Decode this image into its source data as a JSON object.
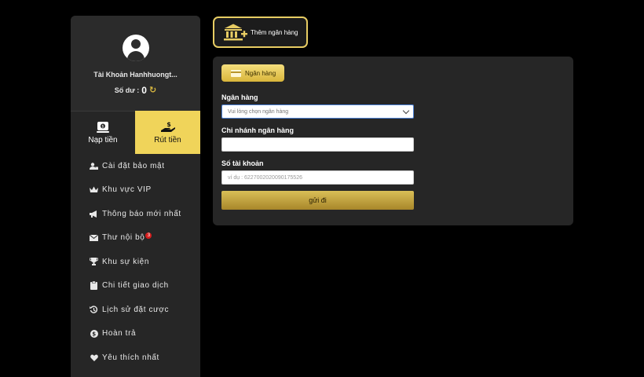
{
  "profile": {
    "account_name": "Tài Khoản Hanhhuongt...",
    "balance_label": "Số dư :",
    "balance_value": "0"
  },
  "tabs": [
    {
      "label": "Nạp tiền",
      "icon": "deposit-icon",
      "active": false
    },
    {
      "label": "Rút tiền",
      "icon": "withdraw-icon",
      "active": true
    }
  ],
  "menu": [
    {
      "label": "Cài đặt bảo mật",
      "icon": "user-lock-icon"
    },
    {
      "label": "Khu vực VIP",
      "icon": "crown-icon"
    },
    {
      "label": "Thông báo mới nhất",
      "icon": "megaphone-icon"
    },
    {
      "label": "Thư nội bộ",
      "icon": "envelope-icon",
      "badge": "3"
    },
    {
      "label": "Khu sự kiện",
      "icon": "trophy-icon"
    },
    {
      "label": "Chi tiết giao dịch",
      "icon": "clipboard-icon"
    },
    {
      "label": "Lịch sử đặt cược",
      "icon": "history-icon"
    },
    {
      "label": "Hoàn trả",
      "icon": "coin-icon"
    },
    {
      "label": "Yêu thích nhất",
      "icon": "heart-icon"
    }
  ],
  "add_bank": {
    "label": "Thêm ngân hàng",
    "icon": "bank-plus-icon"
  },
  "form": {
    "tab_label": "Ngân hàng",
    "bank_label": "Ngân hàng",
    "bank_select_value": "Vui lòng chọn ngân hàng",
    "branch_label": "Chi nhánh ngân hàng",
    "branch_value": "",
    "account_label": "Số tài khoản",
    "account_placeholder": "ví dụ : 6227002020090175526",
    "submit_label": "gửi đi"
  },
  "colors": {
    "accent": "#f0d45a",
    "panel": "#262626",
    "background": "#000000",
    "badge": "#d61e1e"
  }
}
